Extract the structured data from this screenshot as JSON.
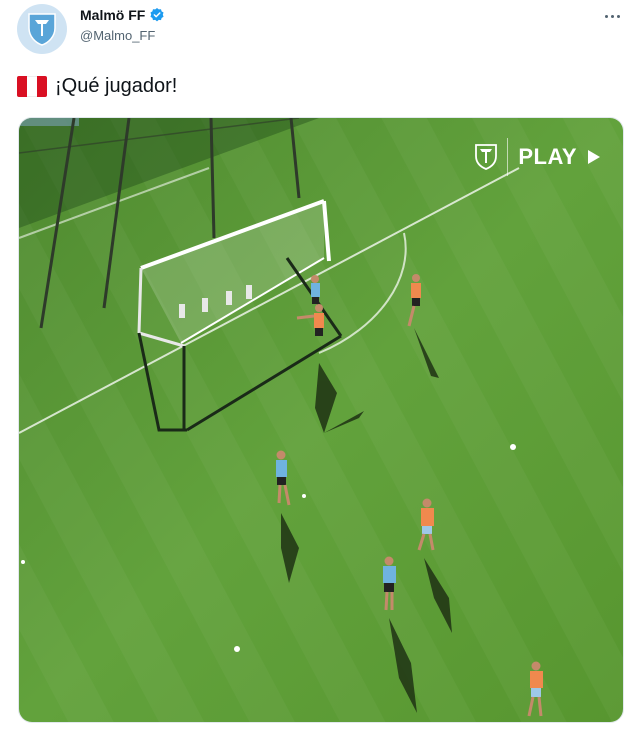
{
  "tweet": {
    "display_name": "Malmö FF",
    "handle": "@Malmo_FF",
    "text": "¡Qué jugador!",
    "flag_icon": "peru-flag-icon",
    "more_icon": "more-options-icon"
  },
  "media": {
    "overlay_label": "PLAY",
    "overlay_logo_icon": "malmo-ff-crest-icon",
    "overlay_arrow_icon": "play-arrow-icon"
  },
  "colors": {
    "pitch": "#5f9a3a",
    "pitch_light": "#6aa845",
    "sky_blue_kit": "#6fb3e0",
    "orange_bib": "#f0894e",
    "verified": "#1d9bf0"
  }
}
